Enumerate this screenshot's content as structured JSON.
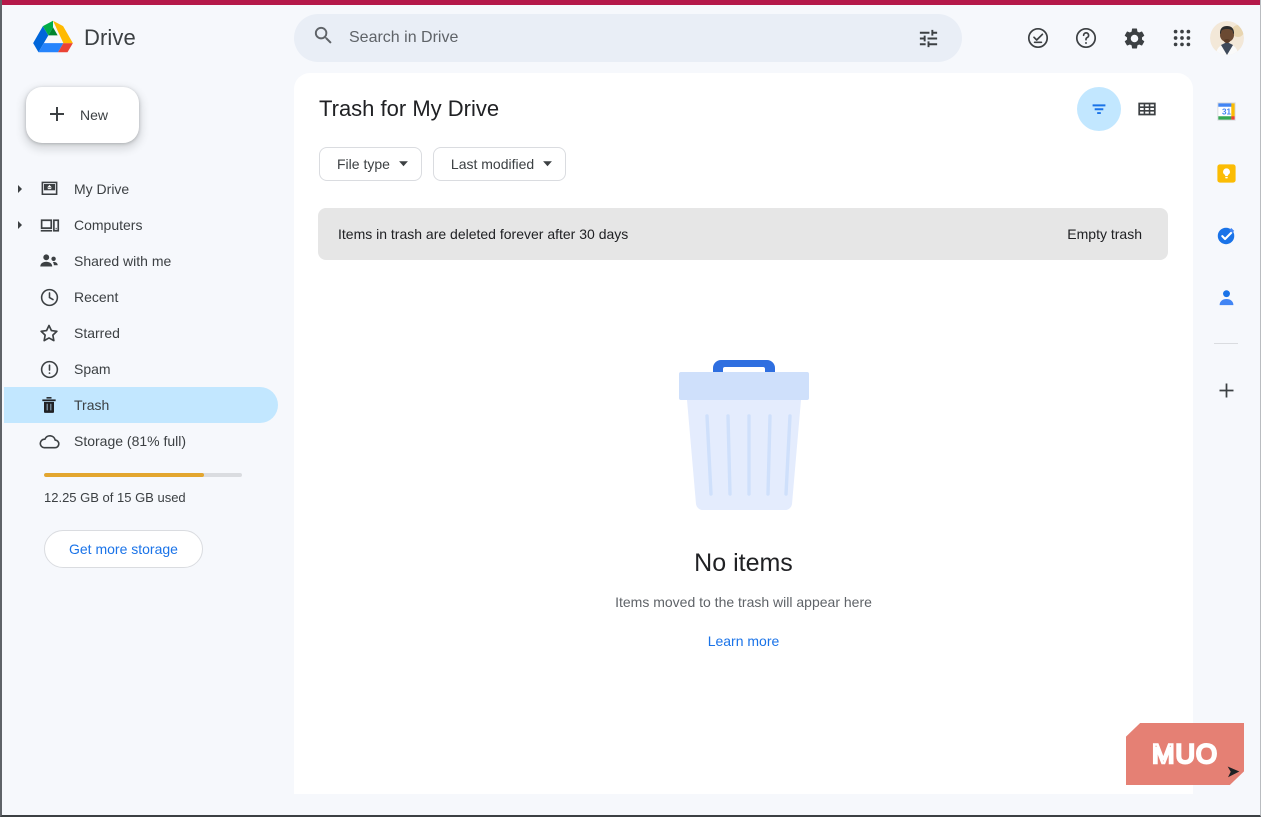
{
  "window": {
    "accent_top_color": "#B5194A"
  },
  "header": {
    "brand": "Drive",
    "logo_icon": "google-drive-logo",
    "search": {
      "placeholder": "Search in Drive",
      "value": "",
      "search_icon": "search-icon",
      "options_icon": "tune-options-icon"
    },
    "actions": [
      {
        "name": "active-tasks-icon",
        "label": "Active"
      },
      {
        "name": "help-icon",
        "label": "Support"
      },
      {
        "name": "gear-icon",
        "label": "Settings"
      },
      {
        "name": "apps-grid-icon",
        "label": "Google apps"
      }
    ],
    "avatar_label": "Google Account"
  },
  "sidebar": {
    "new_button": {
      "label": "New",
      "icon": "plus-icon"
    },
    "items": [
      {
        "label": "My Drive",
        "icon": "my-drive-icon",
        "expandable": true,
        "active": false
      },
      {
        "label": "Computers",
        "icon": "computers-icon",
        "expandable": true,
        "active": false
      },
      {
        "label": "Shared with me",
        "icon": "shared-with-me-icon",
        "expandable": false,
        "active": false
      },
      {
        "label": "Recent",
        "icon": "clock-icon",
        "expandable": false,
        "active": false
      },
      {
        "label": "Starred",
        "icon": "star-icon",
        "expandable": false,
        "active": false
      },
      {
        "label": "Spam",
        "icon": "spam-icon",
        "expandable": false,
        "active": false
      },
      {
        "label": "Trash",
        "icon": "trash-icon",
        "expandable": false,
        "active": true
      },
      {
        "label": "Storage (81% full)",
        "icon": "cloud-icon",
        "expandable": false,
        "active": false
      }
    ],
    "storage": {
      "percent": 81,
      "used_text": "12.25 GB of 15 GB used",
      "bar_color": "#E3A62F",
      "button_label": "Get more storage"
    }
  },
  "main": {
    "title": "Trash for My Drive",
    "head_icons": [
      {
        "name": "filter-icon",
        "label": "Filters",
        "active": true
      },
      {
        "name": "grid-view-icon",
        "label": "Grid view",
        "active": false
      }
    ],
    "chips": [
      {
        "label": "File type",
        "icon": "chevron-down-icon"
      },
      {
        "label": "Last modified",
        "icon": "chevron-down-icon"
      }
    ],
    "banner": {
      "message": "Items in trash are deleted forever after 30 days",
      "action_label": "Empty trash"
    },
    "empty_state": {
      "illustration": "empty-trash-can-illustration",
      "title": "No items",
      "subtitle": "Items moved to the trash will appear here",
      "link_label": "Learn more"
    }
  },
  "rail": {
    "items": [
      {
        "name": "google-calendar-icon",
        "label": "Calendar"
      },
      {
        "name": "google-keep-icon",
        "label": "Keep"
      },
      {
        "name": "google-tasks-icon",
        "label": "Tasks"
      },
      {
        "name": "google-contacts-icon",
        "label": "Contacts"
      }
    ],
    "add_label": "Get add-ons",
    "add_icon": "plus-icon"
  },
  "watermark": {
    "text": "MUO"
  }
}
